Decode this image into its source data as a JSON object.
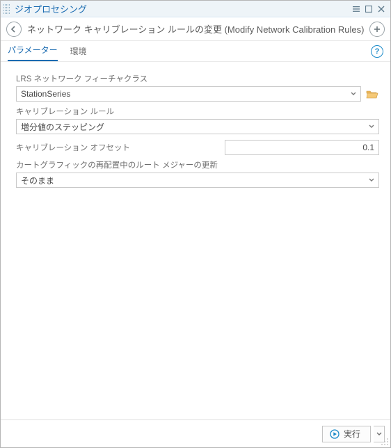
{
  "window": {
    "title": "ジオプロセシング"
  },
  "tool": {
    "title": "ネットワーク キャリブレーション ルールの変更 (Modify Network Calibration Rules)"
  },
  "tabs": {
    "parameters": "パラメーター",
    "environments": "環境"
  },
  "fields": {
    "lrs_network": {
      "label": "LRS ネットワーク フィーチャクラス",
      "value": "StationSeries"
    },
    "calibration_rule": {
      "label": "キャリブレーション ルール",
      "value": "増分値のステッピング"
    },
    "calibration_offset": {
      "label": "キャリブレーション オフセット",
      "value": "0.1"
    },
    "update_measures": {
      "label": "カートグラフィックの再配置中のルート メジャーの更新",
      "value": "そのまま"
    }
  },
  "footer": {
    "run_label": "実行"
  },
  "colors": {
    "accent": "#1a6bb1",
    "folder": "#e6a43a"
  }
}
